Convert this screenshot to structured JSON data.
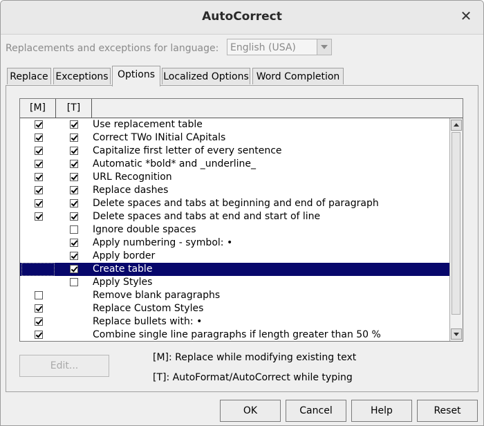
{
  "window": {
    "title": "AutoCorrect"
  },
  "language": {
    "label": "Replacements and exceptions for language:",
    "value": "English (USA)"
  },
  "tabs": [
    {
      "label": "Replace",
      "active": false
    },
    {
      "label": "Exceptions",
      "active": false
    },
    {
      "label": "Options",
      "active": true
    },
    {
      "label": "Localized Options",
      "active": false
    },
    {
      "label": "Word Completion",
      "active": false
    }
  ],
  "options_list": {
    "headers": {
      "m": "[M]",
      "t": "[T]"
    },
    "rows": [
      {
        "label": "Use replacement table",
        "m": true,
        "t": true,
        "selected": false
      },
      {
        "label": "Correct TWo INitial CApitals",
        "m": true,
        "t": true,
        "selected": false
      },
      {
        "label": "Capitalize first letter of every sentence",
        "m": true,
        "t": true,
        "selected": false
      },
      {
        "label": "Automatic *bold* and _underline_",
        "m": true,
        "t": true,
        "selected": false
      },
      {
        "label": "URL Recognition",
        "m": true,
        "t": true,
        "selected": false
      },
      {
        "label": "Replace dashes",
        "m": true,
        "t": true,
        "selected": false
      },
      {
        "label": "Delete spaces and tabs at beginning and end of paragraph",
        "m": true,
        "t": true,
        "selected": false
      },
      {
        "label": "Delete spaces and tabs at end and start of line",
        "m": true,
        "t": true,
        "selected": false
      },
      {
        "label": "Ignore double spaces",
        "m": null,
        "t": false,
        "selected": false
      },
      {
        "label": "Apply numbering - symbol: •",
        "m": null,
        "t": true,
        "selected": false
      },
      {
        "label": "Apply border",
        "m": null,
        "t": true,
        "selected": false
      },
      {
        "label": "Create table",
        "m": null,
        "t": true,
        "selected": true
      },
      {
        "label": "Apply Styles",
        "m": null,
        "t": false,
        "selected": false
      },
      {
        "label": "Remove blank paragraphs",
        "m": false,
        "t": null,
        "selected": false
      },
      {
        "label": "Replace Custom Styles",
        "m": true,
        "t": null,
        "selected": false
      },
      {
        "label": "Replace bullets with: •",
        "m": true,
        "t": null,
        "selected": false
      },
      {
        "label": "Combine single line paragraphs if length greater than 50 %",
        "m": true,
        "t": null,
        "selected": false
      }
    ]
  },
  "edit_button": {
    "label": "Edit..."
  },
  "notes": {
    "m": "[M]: Replace while modifying existing text",
    "t": "[T]: AutoFormat/AutoCorrect while typing"
  },
  "buttons": {
    "ok": "OK",
    "cancel": "Cancel",
    "help": "Help",
    "reset": "Reset"
  },
  "colors": {
    "selection": "#07076b",
    "dialog_bg": "#efefef"
  }
}
